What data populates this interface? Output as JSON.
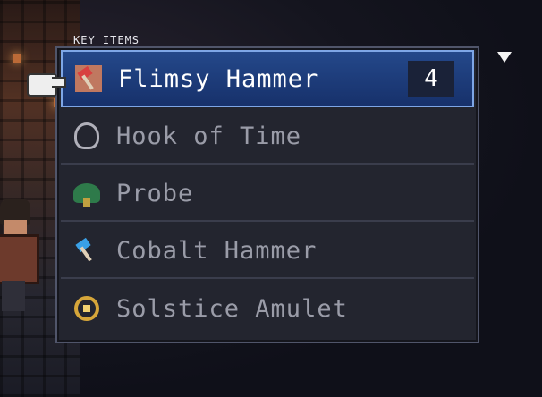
{
  "menu": {
    "title": "KEY ITEMS",
    "items": [
      {
        "label": "Flimsy Hammer",
        "icon": "flimsy-hammer-icon",
        "quantity": "4",
        "selected": true
      },
      {
        "label": "Hook of Time",
        "icon": "hook-of-time-icon",
        "selected": false
      },
      {
        "label": "Probe",
        "icon": "probe-icon",
        "selected": false
      },
      {
        "label": "Cobalt Hammer",
        "icon": "cobalt-hammer-icon",
        "selected": false
      },
      {
        "label": "Solstice Amulet",
        "icon": "solstice-amulet-icon",
        "selected": false
      }
    ]
  },
  "colors": {
    "panel_bg": "#23252f",
    "selected_bg": "#1e3f7e",
    "selected_border": "#7ea6e6",
    "text_selected": "#ffffff",
    "text_normal": "#9a9ca8"
  }
}
